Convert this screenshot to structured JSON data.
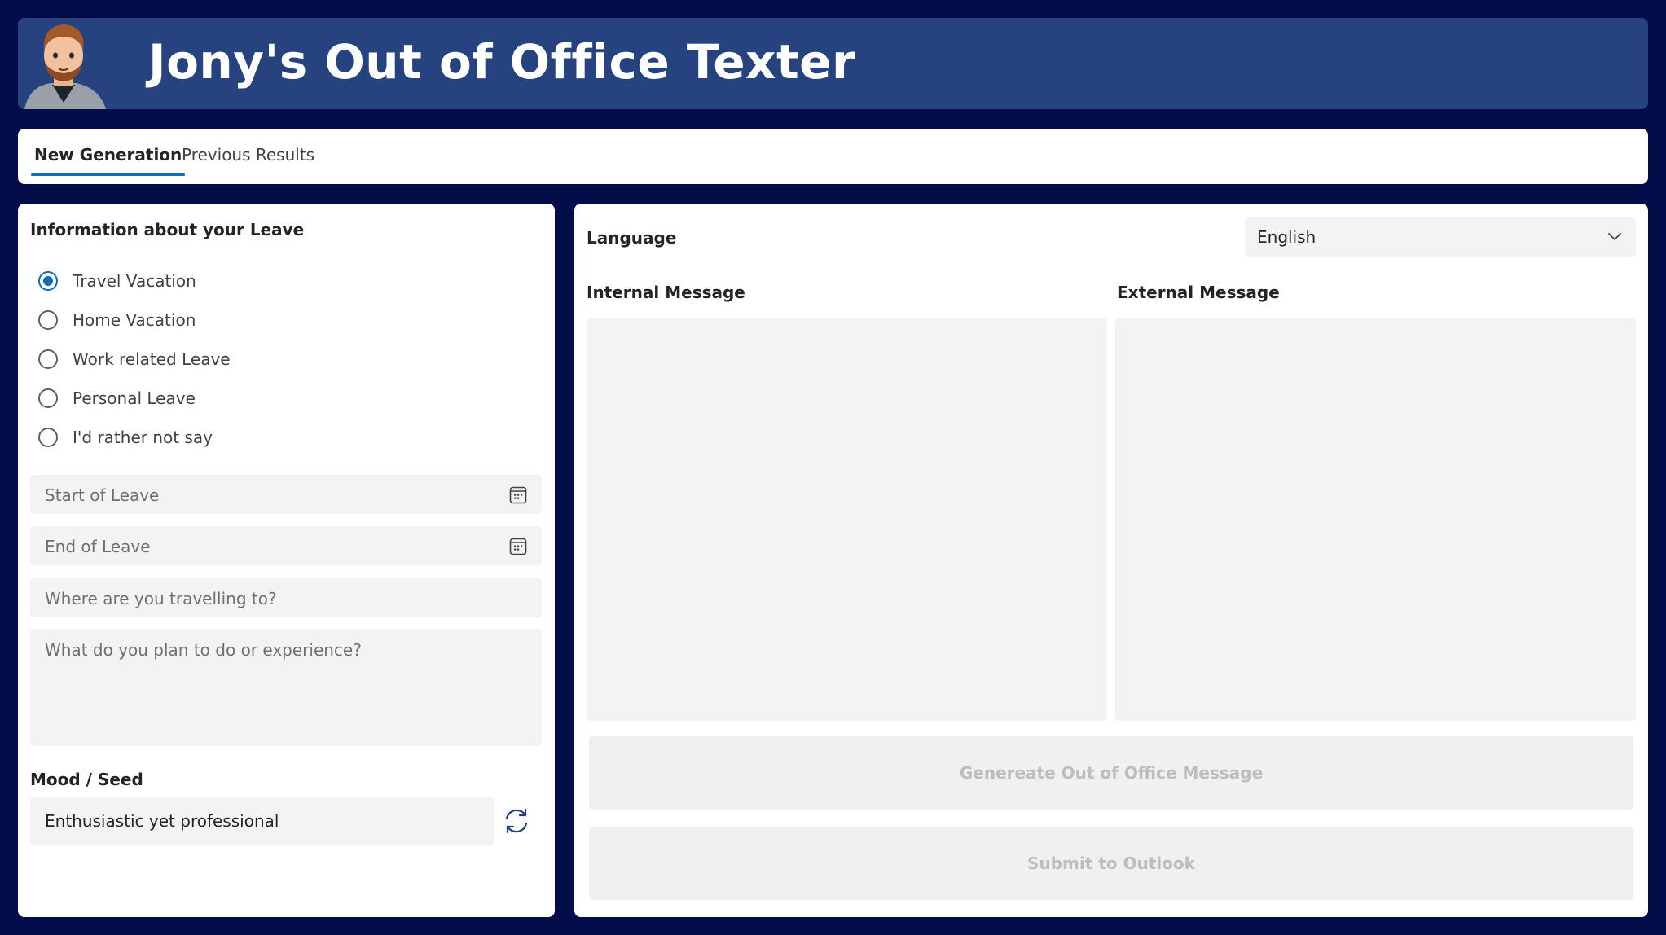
{
  "header": {
    "title": "Jony's Out of Office Texter",
    "background": "#27437f"
  },
  "tabs": [
    {
      "label": "New Generation",
      "active": true
    },
    {
      "label": "Previous Results",
      "active": false
    }
  ],
  "leave_form": {
    "title": "Information about your Leave",
    "leave_types": [
      {
        "label": "Travel Vacation",
        "selected": true
      },
      {
        "label": "Home Vacation",
        "selected": false
      },
      {
        "label": "Work related Leave",
        "selected": false
      },
      {
        "label": "Personal Leave",
        "selected": false
      },
      {
        "label": "I'd rather not say",
        "selected": false
      }
    ],
    "start_placeholder": "Start of Leave",
    "end_placeholder": "End of Leave",
    "destination_placeholder": "Where are you travelling to?",
    "plans_placeholder": "What do you plan to do or experience?",
    "mood_label": "Mood / Seed",
    "mood_value": "Enthusiastic yet professional"
  },
  "output": {
    "language_label": "Language",
    "language_value": "English",
    "internal_label": "Internal Message",
    "external_label": "External Message",
    "generate_button": "Genereate Out of Office Message",
    "submit_button": "Submit to Outlook"
  },
  "colors": {
    "page_background": "#020d4a",
    "accent": "#0f6cbd"
  },
  "icons": [
    "avatar-image",
    "calendar-icon",
    "refresh-icon",
    "chevron-down-icon"
  ]
}
